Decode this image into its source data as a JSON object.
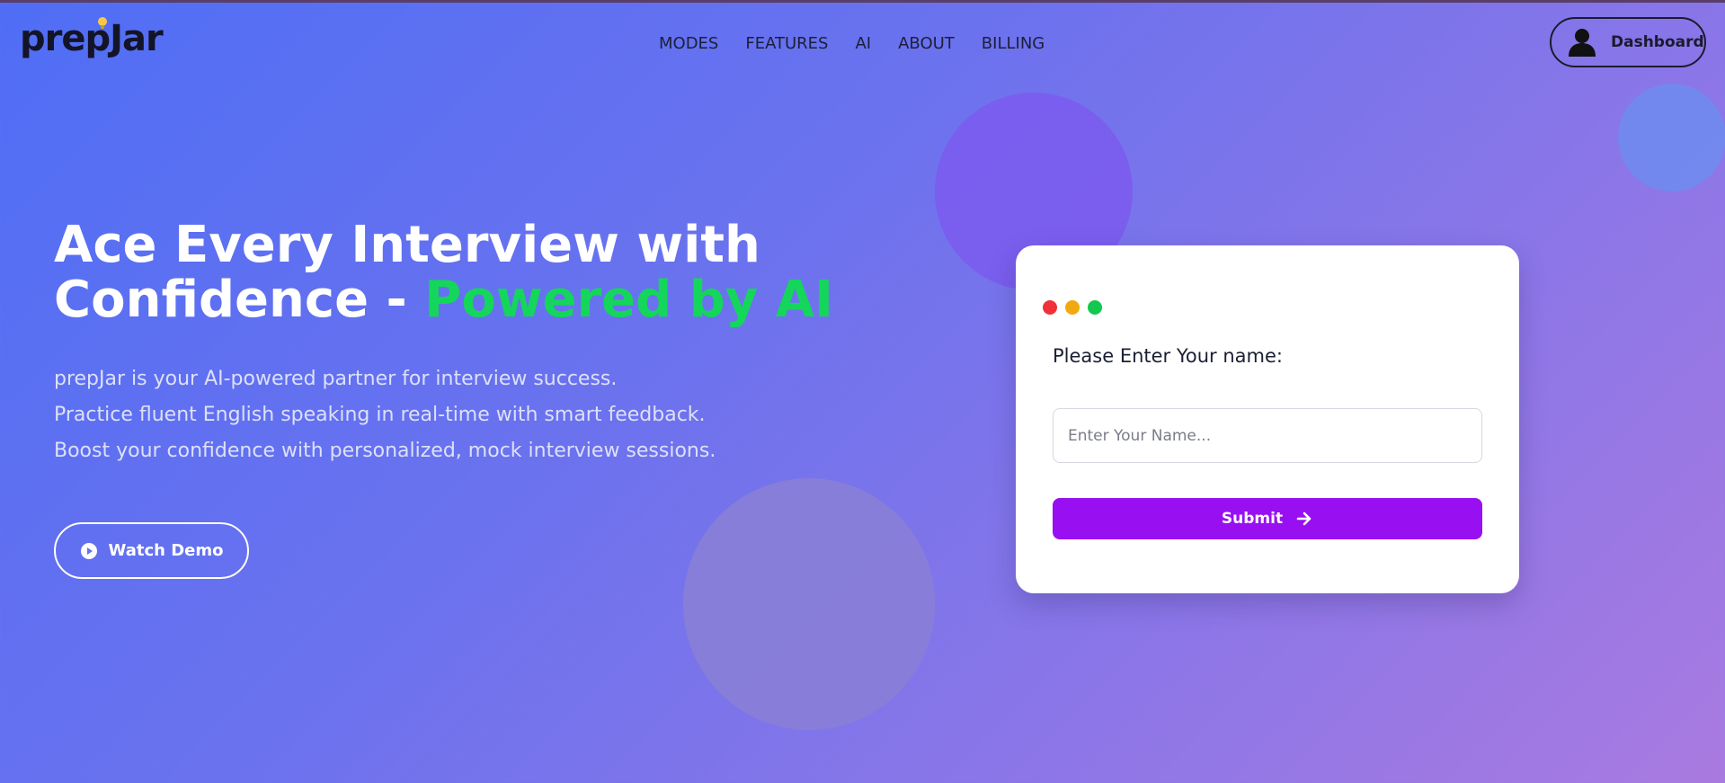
{
  "brand": {
    "logo_text": "prepJar",
    "logo_icon": "lightbulb-icon"
  },
  "nav": {
    "items": [
      {
        "label": "MODES"
      },
      {
        "label": "FEATURES"
      },
      {
        "label": "AI"
      },
      {
        "label": "ABOUT"
      },
      {
        "label": "BILLING"
      }
    ]
  },
  "header": {
    "dashboard_label": "Dashboard",
    "dashboard_icon": "user-avatar-icon"
  },
  "hero": {
    "title_line1": "Ace Every Interview with",
    "title_line2_prefix": "Confidence - ",
    "title_line2_accent": "Powered by AI",
    "description": [
      "prepJar is your AI-powered partner for interview success.",
      "Practice fluent English speaking in real-time with smart feedback.",
      "Boost your confidence with personalized, mock interview sessions."
    ],
    "watch_demo_label": "Watch Demo",
    "watch_demo_icon": "play-circle-icon"
  },
  "card": {
    "window_dots": [
      "#f0313a",
      "#f2a90f",
      "#13c84f"
    ],
    "label": "Please Enter Your name:",
    "input_placeholder": "Enter Your Name...",
    "input_value": "",
    "submit_label": "Submit",
    "submit_icon": "arrow-right-icon"
  },
  "colors": {
    "accent_green": "#14d65a",
    "submit_purple": "#9810f2",
    "gradient_start": "#4f6ef5",
    "gradient_end": "#a97ae0"
  }
}
